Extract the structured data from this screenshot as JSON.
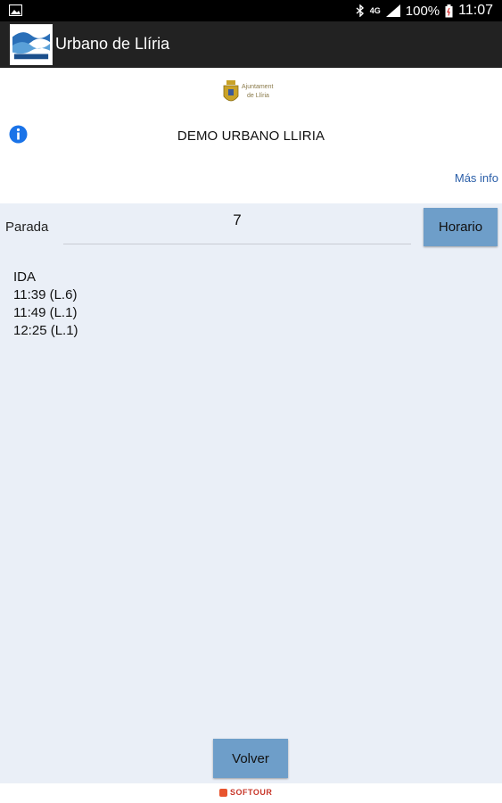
{
  "status_bar": {
    "network": "4G",
    "battery": "100%",
    "time": "11:07"
  },
  "app": {
    "title": "Urbano de Llíria"
  },
  "header": {
    "crest_text_line1": "Ajuntament",
    "crest_text_line2": "de Llíria",
    "title": "DEMO URBANO LLIRIA",
    "more_info_link": "Más info"
  },
  "stop_form": {
    "label": "Parada",
    "value": "7",
    "button_label": "Horario"
  },
  "schedule": {
    "direction": "IDA",
    "arrivals": [
      "11:39 (L.6)",
      "11:49 (L.1)",
      "12:25 (L.1)"
    ]
  },
  "footer": {
    "back_button_label": "Volver",
    "brand": "SOFTOUR"
  },
  "colors": {
    "button_bg": "#6e9ec9",
    "main_bg": "#eaeff7",
    "action_bar": "#222222",
    "info_icon": "#1a73e8",
    "link": "#2a5ea8"
  }
}
